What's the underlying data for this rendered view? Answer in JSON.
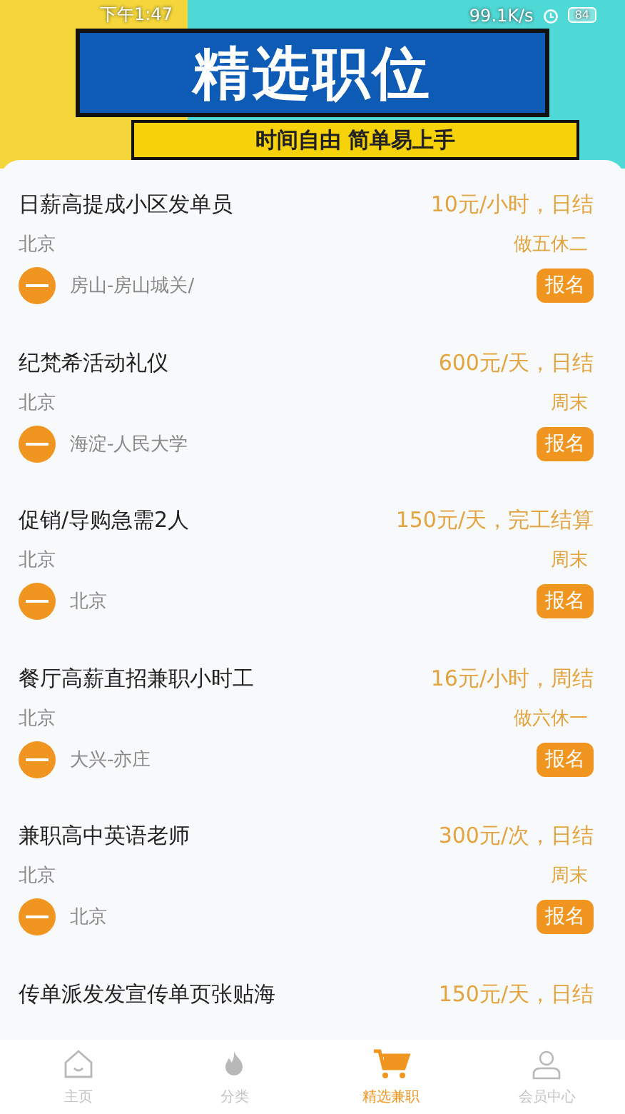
{
  "status_bar": {
    "time": "下午1:47",
    "speed": "99.1K/s",
    "battery": "84"
  },
  "banner": {
    "title": "精选职位",
    "subtitle": "时间自由 简单易上手"
  },
  "jobs": [
    {
      "title": "日薪高提成小区发单员",
      "salary": "10元/小时，日结",
      "city": "北京",
      "schedule": "做五休二",
      "location": "房山-房山城关/",
      "button": "报名"
    },
    {
      "title": "纪梵希活动礼仪",
      "salary": "600元/天，日结",
      "city": "北京",
      "schedule": "周末",
      "location": "海淀-人民大学",
      "button": "报名"
    },
    {
      "title": "促销/导购急需2人",
      "salary": "150元/天，完工结算",
      "city": "北京",
      "schedule": "周末",
      "location": "北京",
      "button": "报名"
    },
    {
      "title": "餐厅高薪直招兼职小时工",
      "salary": "16元/小时，周结",
      "city": "北京",
      "schedule": "做六休一",
      "location": "大兴-亦庄",
      "button": "报名"
    },
    {
      "title": "兼职高中英语老师",
      "salary": "300元/次，日结",
      "city": "北京",
      "schedule": "周末",
      "location": "北京",
      "button": "报名"
    },
    {
      "title": "传单派发发宣传单页张贴海",
      "salary": "150元/天，日结"
    }
  ],
  "tab_bar": [
    {
      "kind": "home",
      "label": "主页",
      "selected": false
    },
    {
      "kind": "fire",
      "label": "分类",
      "selected": false
    },
    {
      "kind": "cart",
      "label": "精选兼职",
      "selected": true
    },
    {
      "kind": "person",
      "label": "会员中心",
      "selected": false
    }
  ]
}
